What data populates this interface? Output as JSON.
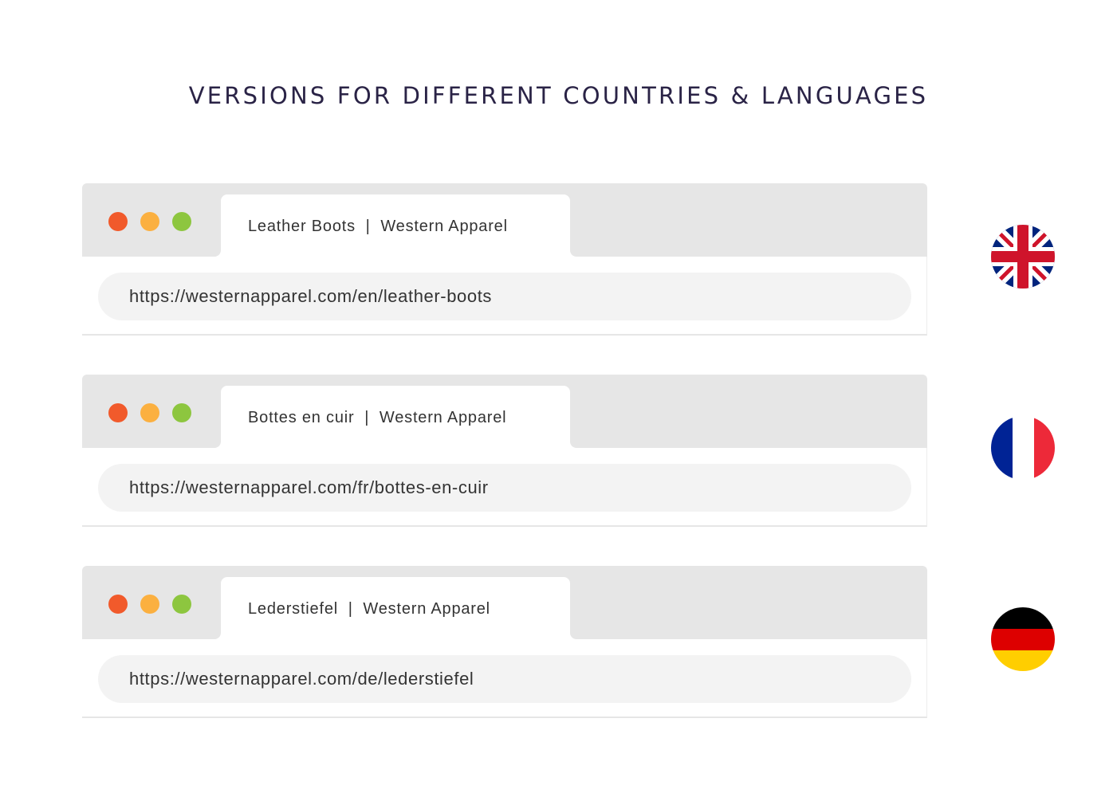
{
  "title": "VERSIONS FOR DIFFERENT COUNTRIES & LANGUAGES",
  "colors": {
    "title": "#2a2346",
    "window_close": "#f15a2b",
    "window_minimize": "#fbb040",
    "window_maximize": "#8dc63f",
    "titlebar": "#e6e6e6",
    "address_bar": "#f3f3f3"
  },
  "versions": [
    {
      "language": "English",
      "flag_icon": "uk-flag-icon",
      "tab_title": "Leather Boots  |  Western Apparel",
      "url": "https://westernapparel.com/en/leather-boots"
    },
    {
      "language": "French",
      "flag_icon": "france-flag-icon",
      "tab_title": "Bottes en cuir  |  Western Apparel",
      "url": "https://westernapparel.com/fr/bottes-en-cuir"
    },
    {
      "language": "German",
      "flag_icon": "germany-flag-icon",
      "tab_title": "Lederstiefel  |  Western Apparel",
      "url": "https://westernapparel.com/de/lederstiefel"
    }
  ]
}
